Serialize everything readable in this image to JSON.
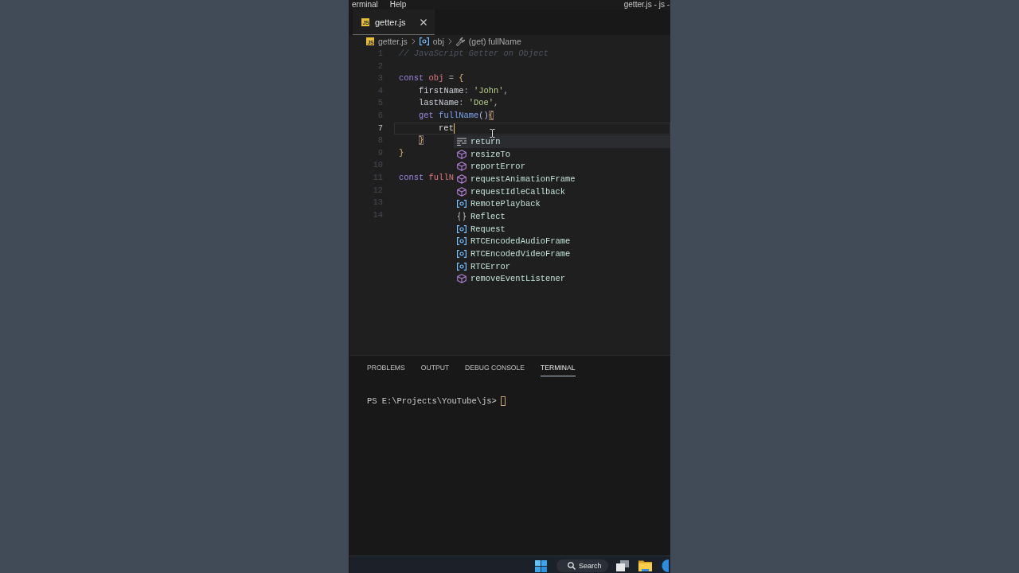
{
  "menu_bar": {
    "items": [
      {
        "label": "erminal"
      },
      {
        "label": "Help"
      }
    ],
    "window_title": "getter.js - js -"
  },
  "tabs": [
    {
      "label": "getter.js",
      "icon_label": "JS",
      "selected": true
    }
  ],
  "breadcrumbs": [
    {
      "label": "getter.js",
      "kind": "file",
      "icon_label": "JS"
    },
    {
      "label": "obj",
      "kind": "variable"
    },
    {
      "label": "(get) fullName",
      "kind": "property"
    }
  ],
  "editor": {
    "lines": [
      {
        "number": "1",
        "current": false,
        "tokens": [
          {
            "kind": "comment",
            "text": "// JavaScript Getter on Object"
          }
        ]
      },
      {
        "number": "2",
        "current": false
      },
      {
        "number": "3",
        "current": false,
        "tokens": [
          {
            "kind": "keyword",
            "text": "const"
          },
          {
            "kind": "variable",
            "text": " obj"
          },
          {
            "kind": "operator",
            "text": " ="
          },
          {
            "kind": "brace",
            "text": " {"
          }
        ]
      },
      {
        "number": "4",
        "current": false,
        "tokens": [
          {
            "kind": "property",
            "text": "    firstName"
          },
          {
            "kind": "punct",
            "text": ": "
          },
          {
            "kind": "string",
            "text": "'John'"
          },
          {
            "kind": "punct",
            "text": ","
          }
        ]
      },
      {
        "number": "5",
        "current": false,
        "tokens": [
          {
            "kind": "property",
            "text": "    lastName"
          },
          {
            "kind": "punct",
            "text": ": "
          },
          {
            "kind": "string",
            "text": "'Doe'"
          },
          {
            "kind": "punct",
            "text": ","
          }
        ]
      },
      {
        "number": "6",
        "current": false,
        "tokens": [
          {
            "kind": "keyword",
            "text": "    get"
          },
          {
            "kind": "function",
            "text": " fullName"
          },
          {
            "kind": "paren",
            "text": "()"
          },
          {
            "kind": "brace_match",
            "text": "{"
          }
        ]
      },
      {
        "number": "7",
        "current": true,
        "tokens": [
          {
            "kind": "plain",
            "text": "        ret"
          }
        ]
      },
      {
        "number": "8",
        "current": false,
        "tokens": [
          {
            "kind": "brace_match",
            "text": "    }"
          }
        ]
      },
      {
        "number": "9",
        "current": false,
        "tokens": [
          {
            "kind": "brace",
            "text": "}"
          }
        ]
      },
      {
        "number": "10",
        "current": false
      },
      {
        "number": "11",
        "current": false,
        "tokens": [
          {
            "kind": "keyword",
            "text": "const"
          },
          {
            "kind": "variable",
            "text": " fullN"
          }
        ]
      },
      {
        "number": "12",
        "current": false
      },
      {
        "number": "13",
        "current": false
      },
      {
        "number": "14",
        "current": false
      }
    ]
  },
  "suggestions": [
    {
      "label": "return",
      "kind": "keyword",
      "selected": true
    },
    {
      "label": "resizeTo",
      "kind": "method",
      "selected": false
    },
    {
      "label": "reportError",
      "kind": "method",
      "selected": false
    },
    {
      "label": "requestAnimationFrame",
      "kind": "method",
      "selected": false
    },
    {
      "label": "requestIdleCallback",
      "kind": "method",
      "selected": false
    },
    {
      "label": "RemotePlayback",
      "kind": "variable",
      "selected": false
    },
    {
      "label": "Reflect",
      "kind": "namespace",
      "selected": false
    },
    {
      "label": "Request",
      "kind": "variable",
      "selected": false
    },
    {
      "label": "RTCEncodedAudioFrame",
      "kind": "variable",
      "selected": false
    },
    {
      "label": "RTCEncodedVideoFrame",
      "kind": "variable",
      "selected": false
    },
    {
      "label": "RTCError",
      "kind": "variable",
      "selected": false
    },
    {
      "label": "removeEventListener",
      "kind": "method",
      "selected": false
    }
  ],
  "panel": {
    "tabs": [
      {
        "label": "PROBLEMS",
        "selected": false
      },
      {
        "label": "OUTPUT",
        "selected": false
      },
      {
        "label": "DEBUG CONSOLE",
        "selected": false
      },
      {
        "label": "TERMINAL",
        "selected": true
      }
    ],
    "terminal": {
      "prompt": "PS E:\\Projects\\YouTube\\js>",
      "cursor": true
    }
  },
  "taskbar": {
    "search_label": "Search"
  }
}
